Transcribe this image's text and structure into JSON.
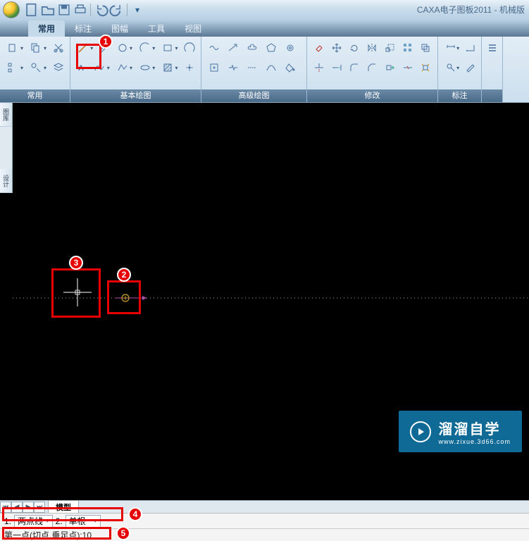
{
  "app": {
    "title": "CAXA电子图板2011 - 机械版"
  },
  "menu": {
    "tabs": [
      "常用",
      "标注",
      "图幅",
      "工具",
      "视图"
    ],
    "activeTab": "常用"
  },
  "ribbon_groups": [
    {
      "label": "常用"
    },
    {
      "label": "基本绘图"
    },
    {
      "label": "高级绘图"
    },
    {
      "label": "修改"
    },
    {
      "label": "标注"
    }
  ],
  "sheet": {
    "tab": "模型"
  },
  "options": {
    "item1_num": "1.",
    "item1_val": "两点线",
    "item2_num": "2.",
    "item2_val": "单根"
  },
  "cmd": {
    "prompt": "第一点(切点,垂足点):10"
  },
  "annotations": {
    "b1": "1",
    "b2": "2",
    "b3": "3",
    "b4": "4",
    "b5": "5"
  },
  "watermark": {
    "brand": "溜溜自学",
    "url": "www.zixue.3d66.com"
  },
  "icons": {
    "new": "new-icon",
    "open": "open-icon",
    "save": "save-icon",
    "print": "print-icon",
    "undo": "undo-icon",
    "redo": "redo-icon"
  }
}
